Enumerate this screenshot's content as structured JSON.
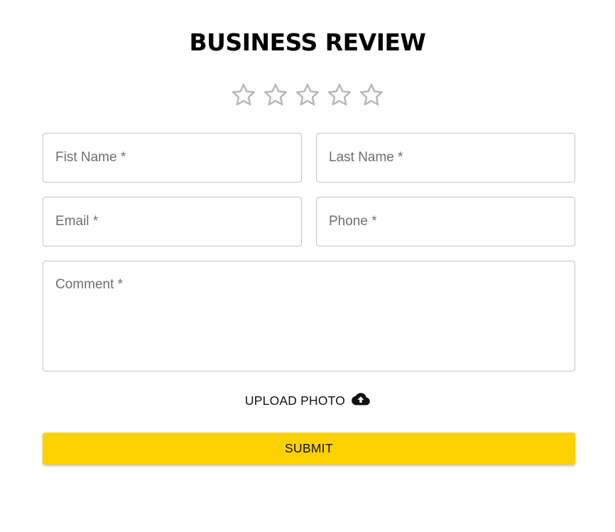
{
  "form": {
    "title": "BUSINESS REVIEW",
    "rating": {
      "value": 0,
      "max": 5,
      "star_color": "#b8b8b8"
    },
    "fields": {
      "first_name": {
        "placeholder": "Fist Name *",
        "value": ""
      },
      "last_name": {
        "placeholder": "Last Name *",
        "value": ""
      },
      "email": {
        "placeholder": "Email *",
        "value": ""
      },
      "phone": {
        "placeholder": "Phone *",
        "value": ""
      },
      "comment": {
        "placeholder": "Comment *",
        "value": ""
      }
    },
    "upload": {
      "label": "UPLOAD PHOTO",
      "icon": "cloud-upload-icon"
    },
    "submit": {
      "label": "SUBMIT",
      "color": "#fdd000"
    }
  }
}
